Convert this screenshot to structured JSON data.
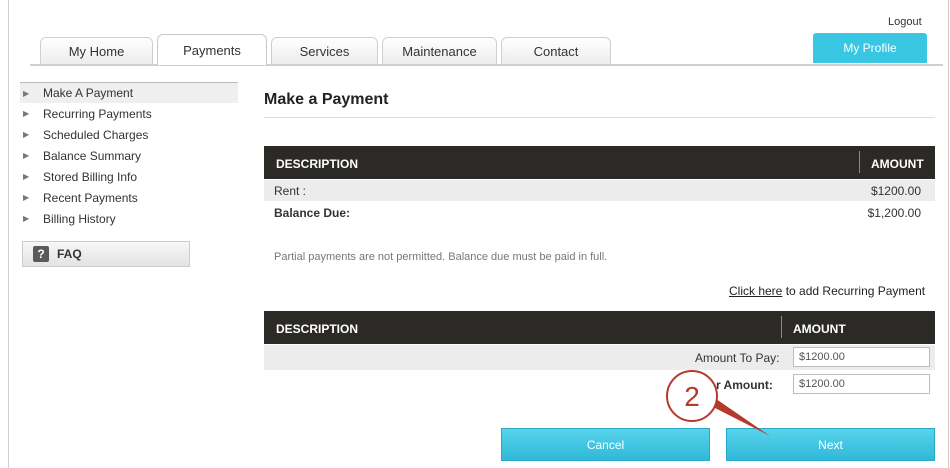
{
  "header": {
    "logout": "Logout",
    "my_profile": "My Profile",
    "tabs": [
      "My Home",
      "Payments",
      "Services",
      "Maintenance",
      "Contact"
    ]
  },
  "sidebar": {
    "items": [
      "Make A Payment",
      "Recurring Payments",
      "Scheduled Charges",
      "Balance Summary",
      "Stored Billing Info",
      "Recent Payments",
      "Billing History"
    ],
    "faq": "FAQ",
    "faq_icon": "?"
  },
  "main": {
    "title": "Make a Payment",
    "table1": {
      "col_description": "DESCRIPTION",
      "col_amount": "AMOUNT",
      "rows": [
        {
          "label": "Rent :",
          "amount": "$1200.00"
        },
        {
          "label": "Balance Due:",
          "amount": "$1,200.00"
        }
      ]
    },
    "note": "Partial payments are not permitted. Balance due must be paid in full.",
    "recurring_link": "Click here",
    "recurring_text": "to add Recurring Payment",
    "table2": {
      "col_description": "DESCRIPTION",
      "col_amount": "AMOUNT",
      "amount_to_pay_label": "Amount To Pay:",
      "amount_to_pay_value": "$1200.00",
      "other_amount_label": "r Amount:",
      "other_amount_value": "$1200.00"
    },
    "cancel": "Cancel",
    "next": "Next"
  },
  "annotation": {
    "step_number": "2",
    "color": "#b53a2a"
  }
}
